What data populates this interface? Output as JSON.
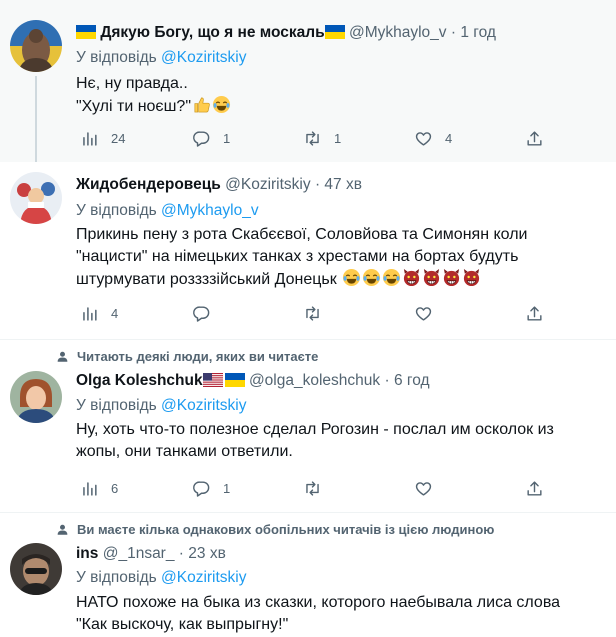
{
  "reply_prefix": "У відповідь",
  "tweets": [
    {
      "name": "Дякую Богу, що я не москаль",
      "handle": "@Mykhaylo_v",
      "sep": "·",
      "time": "1 год",
      "reply_to": "@Koziritskiy",
      "lines": [
        "Нє, ну правда..",
        "\"Хулі ти ноєш?\""
      ],
      "stats": {
        "views": "24",
        "replies": "1",
        "retweets": "1",
        "likes": "4"
      }
    },
    {
      "name": "Жидобендеровець",
      "handle": "@Koziritskiy",
      "sep": "·",
      "time": "47 хв",
      "reply_to": "@Mykhaylo_v",
      "lines": [
        "Прикинь пену з рота Скабєєвої, Соловйова та Симонян коли",
        "\"нацисти\" на німецьких танках з хрестами на бортах будуть",
        "штурмувати рoззззійський Донецьк"
      ],
      "stats": {
        "views": "4"
      }
    },
    {
      "social": "Читають деякі люди, яких ви читаєте",
      "name": "Olga Koleshchuk",
      "handle": "@olga_koleshchuk",
      "sep": "·",
      "time": "6 год",
      "reply_to": "@Koziritskiy",
      "lines": [
        "Ну, хоть что-то полезное сделал Рогозин - послал им осколок из",
        "жопы, они танками ответили."
      ],
      "stats": {
        "views": "6",
        "replies": "1"
      }
    },
    {
      "social": "Ви маєте кілька однакових обопільних читачів із цією людиною",
      "name": "ins",
      "handle": "@_1nsar_",
      "sep": "·",
      "time": "23 хв",
      "reply_to": "@Koziritskiy",
      "lines": [
        "НАТО похоже на быка из сказки, которого наебывала лиса слова",
        "\"Как выскочу, как выпрыгну!\""
      ]
    }
  ],
  "icons": {
    "views": "analytics-icon",
    "reply": "reply-icon",
    "retweet": "retweet-icon",
    "like": "like-icon",
    "share": "share-icon",
    "social": "person-icon"
  },
  "colors": {
    "link": "#1d9bf0",
    "muted": "#536471",
    "text": "#0f1419",
    "flag_blue": "#0057b7",
    "flag_yellow": "#ffd700"
  }
}
